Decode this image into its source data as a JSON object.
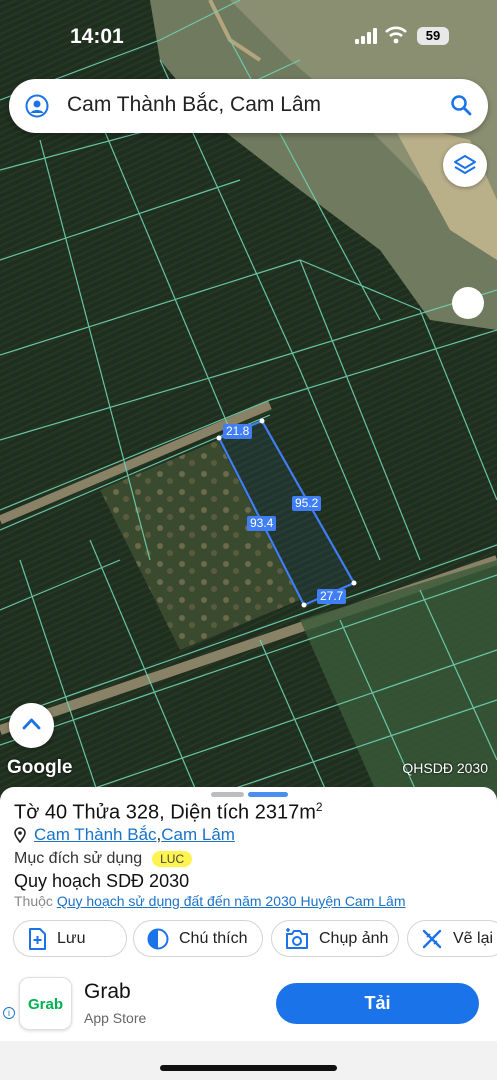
{
  "status_bar": {
    "time": "14:01",
    "battery": "59"
  },
  "search": {
    "query": "Cam Thành Bắc, Cam Lâm"
  },
  "map": {
    "attribution": "Google",
    "layer_label": "QHSDĐ 2030",
    "measurements": {
      "top_edge": "21.8",
      "right_edge": "95.2",
      "left_edge": "93.4",
      "bottom_edge": "27.7"
    }
  },
  "parcel": {
    "title_prefix": "Tờ 40 Thửa 328, Diện tích 2317m",
    "title_sup": "2",
    "commune_link": "Cam Thành Bắc",
    "separator": ", ",
    "district_link": "Cam Lâm",
    "purpose_label": "Mục đích sử dụng",
    "purpose_badge": "LUC",
    "plan_title": "Quy hoạch SDĐ 2030",
    "belong_prefix": "Thuộc",
    "belong_link": "Quy hoạch sử dụng đất đến năm 2030 Huyện Cam Lâm"
  },
  "actions": {
    "save": "Lưu",
    "legend": "Chú thích",
    "capture": "Chụp ảnh",
    "draw": "Vẽ lại"
  },
  "ad": {
    "app_name": "Grab",
    "store": "App Store",
    "logo_text": "Grab",
    "download": "Tải"
  },
  "colors": {
    "accent": "#1a73e8",
    "parcel_line": "#3f7ef5",
    "boundary": "#6fd3b3",
    "badge": "#fff44f"
  }
}
